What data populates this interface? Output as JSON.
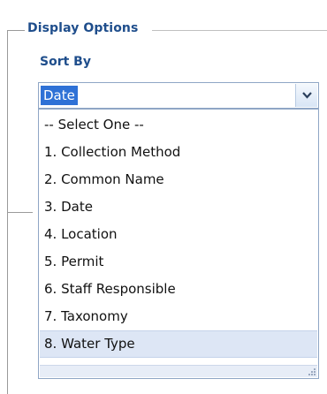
{
  "fieldset": {
    "legend": "Display Options"
  },
  "sort": {
    "label": "Sort By",
    "selected": "Date",
    "options": [
      "-- Select One --",
      "1. Collection Method",
      "2. Common Name",
      "3. Date",
      "4. Location",
      "5. Permit",
      "6. Staff Responsible",
      "7. Taxonomy",
      "8. Water Type"
    ],
    "hovered_index": 8
  },
  "icons": {
    "dropdown_arrow": "chevron-down-icon",
    "resize": "resize-grip-icon"
  },
  "colors": {
    "label": "#1f4e8c",
    "selection": "#2e71d6",
    "hover": "#dde6f5",
    "border": "#8fa6c5"
  }
}
